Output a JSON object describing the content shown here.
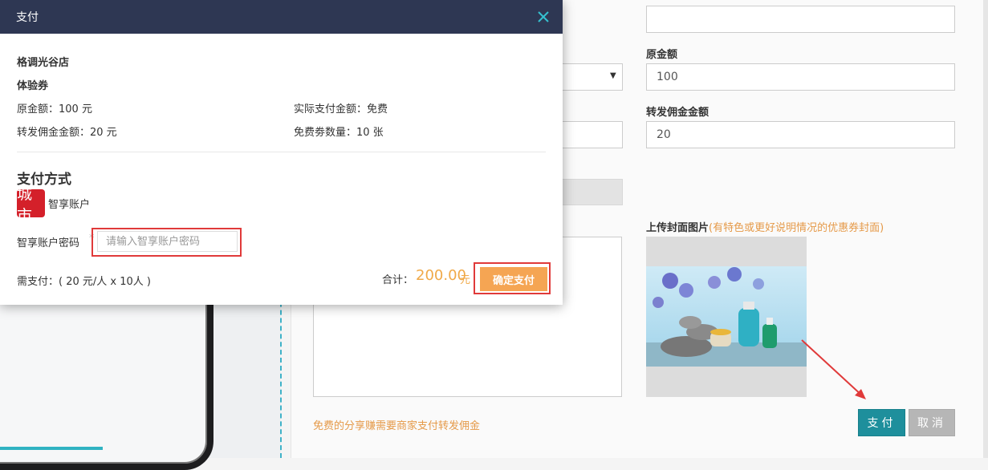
{
  "modal": {
    "title": "支付",
    "store_name": "格调光谷店",
    "coupon_type": "体验券",
    "original_amount": "原金额：100 元",
    "actual_pay": "实际支付金额：免费",
    "commission": "转发佣金金额：20 元",
    "free_count": "免费劵数量：10 张",
    "payment_method_title": "支付方式",
    "account_name": "智享账户",
    "account_logo_text": "城市",
    "password_label": "智享账户密码",
    "password_required_mark": "*",
    "password_placeholder": "请输入智享账户密码",
    "need_pay": "需支付：( 20 元/人 x 10人 )",
    "total_label": "合计：",
    "total_amount": "200.00",
    "total_unit": "元",
    "confirm_button": "确定支付"
  },
  "form": {
    "original_amount_label": "原金额",
    "original_amount_value": "100",
    "commission_label": "转发佣金金额",
    "commission_value": "20",
    "upload_cover_label": "上传封面图片",
    "upload_cover_hint": "(有特色或更好说明情况的优惠券封面)",
    "share_note": "免费的分享赚需要商家支付转发佣金",
    "pay_button": "支付",
    "cancel_button": "取消"
  },
  "colors": {
    "modal_header": "#2e3753",
    "accent_orange": "#f5a553",
    "teal_button": "#1e8f9c",
    "highlight_red": "#e03a3a"
  }
}
